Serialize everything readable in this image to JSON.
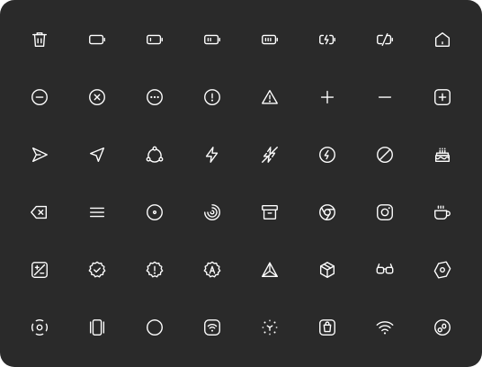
{
  "theme": {
    "background": "#2a2a2a",
    "icon_color": "#ffffff"
  },
  "icons": [
    "trash-icon",
    "battery-empty-icon",
    "battery-low-icon",
    "battery-medium-icon",
    "battery-full-icon",
    "battery-charging-icon",
    "battery-off-icon",
    "home-icon",
    "minus-circle-icon",
    "x-circle-icon",
    "dots-circle-icon",
    "alert-circle-icon",
    "alert-triangle-icon",
    "plus-icon",
    "minus-icon",
    "plus-square-icon",
    "send-icon",
    "navigation-icon",
    "share-nodes-icon",
    "zap-icon",
    "zap-off-icon",
    "bolt-circle-icon",
    "forbidden-icon",
    "cake-icon",
    "backspace-icon",
    "menu-icon",
    "disc-icon",
    "spiral-icon",
    "archive-icon",
    "chrome-icon",
    "instagram-icon",
    "coffee-icon",
    "diff-icon",
    "badge-check-icon",
    "badge-alert-icon",
    "badge-a-icon",
    "triangle-split-icon",
    "box-3d-icon",
    "glasses-icon",
    "tag-rotated-icon",
    "rotate-circle-icon",
    "gallery-icon",
    "loader-circle-icon",
    "wifi-square-icon",
    "focus-dots-icon",
    "shopping-bag-square-icon",
    "wifi-icon",
    "mouse-circle-icon"
  ]
}
